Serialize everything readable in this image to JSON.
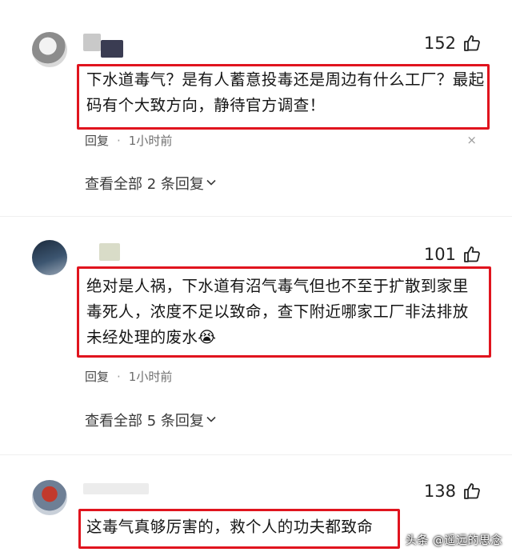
{
  "comments": [
    {
      "likes": "152",
      "text": "下水道毒气？是有人蓄意投毒还是周边有什么工厂？最起码有个大致方向，静待官方调查！",
      "reply_label": "回复",
      "separator": "·",
      "time": "1小时前",
      "view_all": "查看全部 2 条回复",
      "close_icon": "×"
    },
    {
      "likes": "101",
      "text": "绝对是人祸，下水道有沼气毒气但也不至于扩散到家里毒死人，浓度不足以致命，查下附近哪家工厂非法排放未经处理的废水😭",
      "reply_label": "回复",
      "separator": "·",
      "time": "1小时前",
      "view_all": "查看全部 5 条回复"
    },
    {
      "likes": "138",
      "text": "这毒气真够厉害的，救个人的功夫都致命"
    }
  ],
  "watermark": "头条 @遥远的思念",
  "icons": {
    "like": "thumbs-up-icon",
    "chevron": "chevron-down-icon",
    "close": "close-icon"
  },
  "colors": {
    "highlight": "#e0141e"
  }
}
